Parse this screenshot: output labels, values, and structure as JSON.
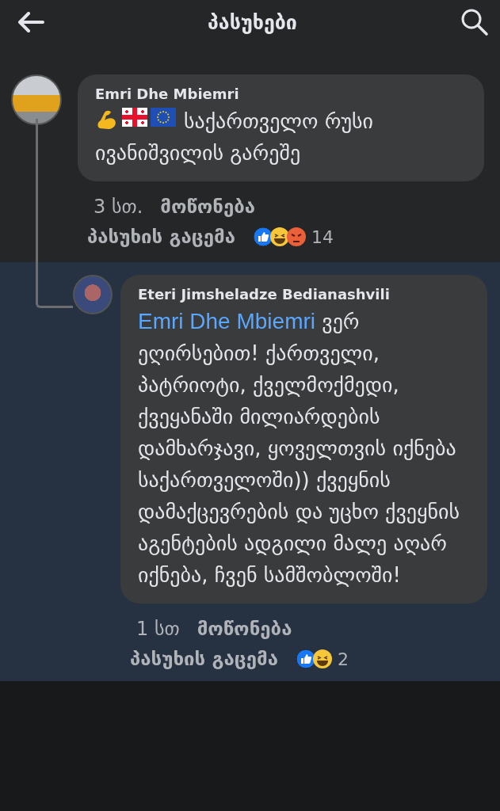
{
  "header": {
    "title": "პასუხები"
  },
  "comment": {
    "author": "Emri Dhe Mbiemri",
    "emojis": [
      {
        "kind": "muscle"
      },
      {
        "kind": "georgia-flag"
      },
      {
        "kind": "eu-flag"
      }
    ],
    "text": "საქართველო რუსი ივანიშვილის გარეშე",
    "time": "3 სთ.",
    "like": "მოწონება",
    "reply": "პასუხის გაცემა",
    "reactions": [
      {
        "kind": "like"
      },
      {
        "kind": "haha"
      },
      {
        "kind": "angry"
      }
    ],
    "count": "14"
  },
  "reply": {
    "author": "Eteri Jimsheladze Bedianashvili",
    "mention": "Emri Dhe Mbiemri",
    "text": "ვერ ეღირსებით! ქართველი, პატრიოტი, ქველმოქმედი, ქვეყანაში მილიარდების დამხარჯავი, ყოველთვის იქნება საქართველოში)) ქვეყნის დამაქცევრების და უცხო ქვეყნის აგენტების ადგილი მალე აღარ იქნება, ჩვენ სამშობლოში!",
    "time": "1 სთ",
    "like": "მოწონება",
    "reply": "პასუხის გაცემა",
    "reactions": [
      {
        "kind": "like"
      },
      {
        "kind": "haha"
      }
    ],
    "count": "2"
  }
}
